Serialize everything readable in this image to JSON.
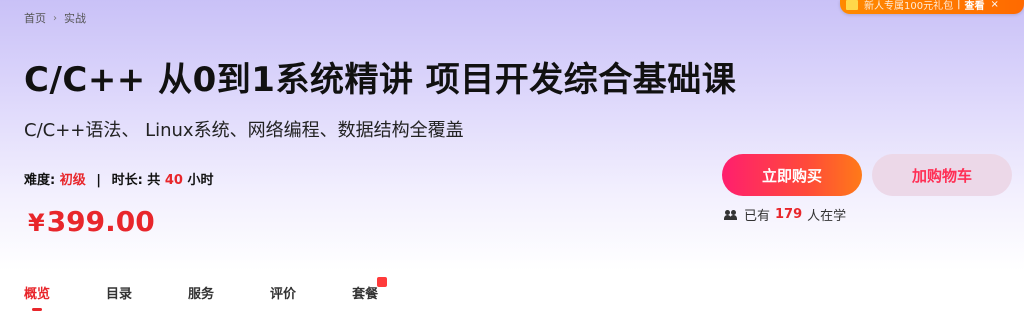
{
  "breadcrumb": {
    "home": "首页",
    "current": "实战"
  },
  "promo": {
    "text": "新人专属100元礼包",
    "view": "查看",
    "close": "×"
  },
  "course": {
    "title": "C/C++ 从0到1系统精讲 项目开发综合基础课",
    "subtitle": "C/C++语法、 Linux系统、网络编程、数据结构全覆盖"
  },
  "meta": {
    "difficulty_label": "难度:",
    "difficulty": "初级",
    "separator": "|",
    "duration_label": "时长:",
    "duration_prefix": "共",
    "duration_value": "40",
    "duration_unit": "小时"
  },
  "price": {
    "symbol": "¥",
    "amount": "399.00"
  },
  "actions": {
    "buy": "立即购买",
    "cart": "加购物车"
  },
  "learners": {
    "prefix": "已有",
    "count": "179",
    "suffix": "人在学"
  },
  "tabs": [
    "概览",
    "目录",
    "服务",
    "评价",
    "套餐"
  ],
  "colors": {
    "accent": "#e8262b",
    "buy_gradient_start": "#ff1f6e",
    "buy_gradient_end": "#ff7a18",
    "promo": "#ff7a00"
  }
}
